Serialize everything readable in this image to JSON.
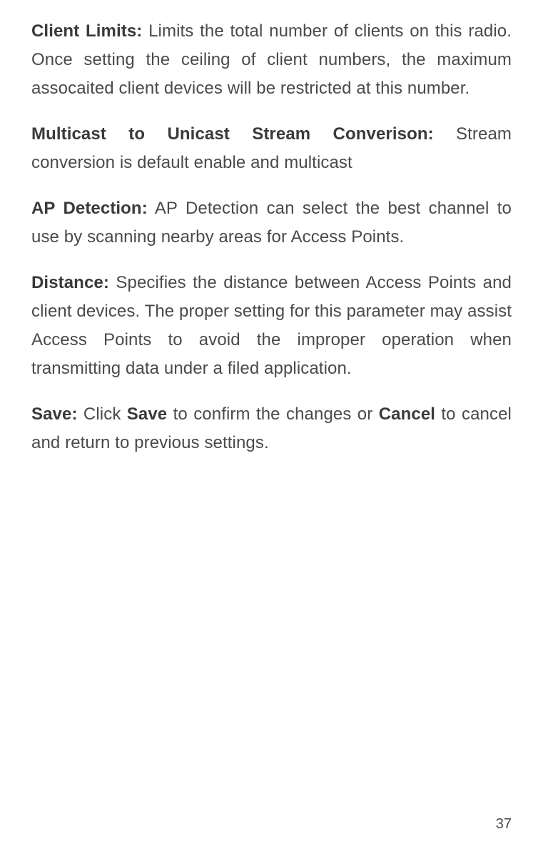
{
  "paragraphs": {
    "p1": {
      "label": "Client Limits:",
      "text": " Limits the total number of clients on this radio. Once setting the ceiling of client numbers, the maximum assocaited client devices will be restricted at this number."
    },
    "p2": {
      "label": "Multicast to Unicast Stream Converison:",
      "text": " Stream conversion is default enable and multicast"
    },
    "p3": {
      "label": "AP Detection:",
      "text": " AP Detection can select the best channel to use by scanning nearby areas for Access Points."
    },
    "p4": {
      "label": "Distance:",
      "text": " Specifies the distance between Access Points and client devices. The proper setting for this parameter may assist Access Points to avoid the improper operation when transmitting data under a filed application."
    },
    "p5": {
      "label": "Save:",
      "text_before": " Click ",
      "bold1": "Save",
      "text_mid": " to confirm the changes or ",
      "bold2": "Cancel",
      "text_after": " to cancel and return to previous settings."
    }
  },
  "page_number": "37"
}
